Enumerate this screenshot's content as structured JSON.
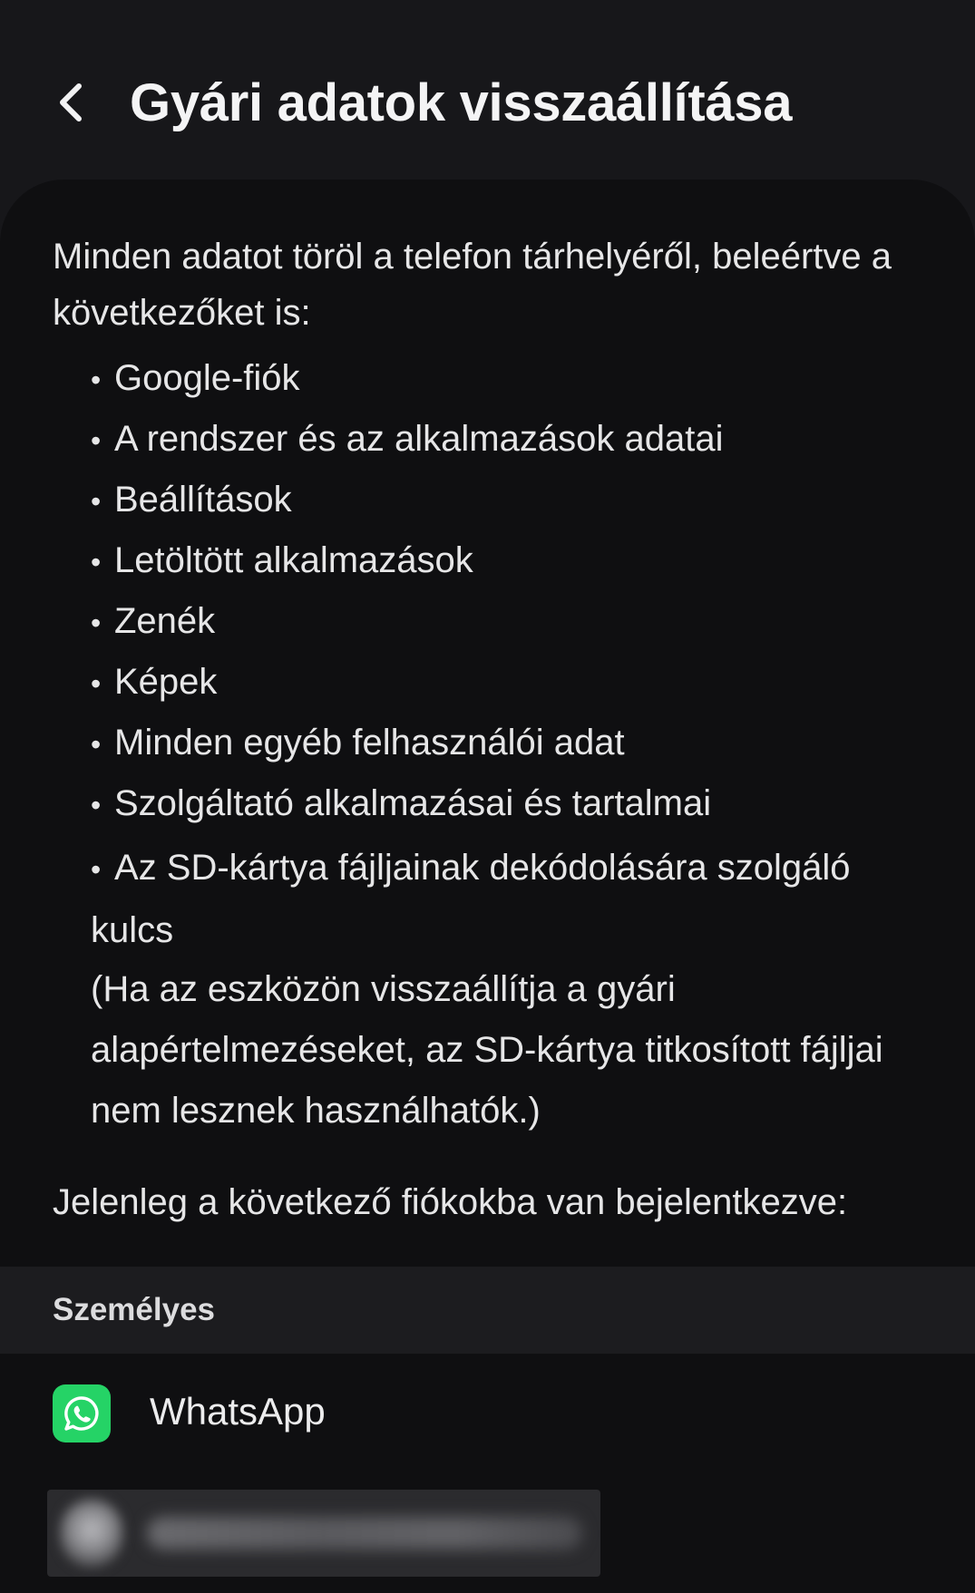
{
  "header": {
    "back_icon": "chevron-left-icon",
    "title": "Gyári adatok visszaállítása"
  },
  "content": {
    "intro": "Minden adatot töröl a telefon tárhelyéről, beleértve a következőket is:",
    "bullets": [
      "Google-fiók",
      "A rendszer és az alkalmazások adatai",
      "Beállítások",
      "Letöltött alkalmazások",
      "Zenék",
      "Képek",
      "Minden egyéb felhasználói adat",
      "Szolgáltató alkalmazásai és tartalmai"
    ],
    "bullet_last": "Az SD-kártya fájljainak dekódolására szolgáló kulcs",
    "note": "(Ha az eszközön visszaállítja a gyári alapértelmezéseket, az SD-kártya titkosított fájljai nem lesznek használhatók.)",
    "accounts_intro": "Jelenleg a következő fiókokba van bejelentkezve:"
  },
  "accounts_section": {
    "title": "Személyes",
    "items": [
      {
        "name": "WhatsApp",
        "icon": "whatsapp-icon"
      }
    ]
  },
  "colors": {
    "background": "#17171a",
    "card": "#0f0f11",
    "whatsapp_green": "#25d366"
  }
}
